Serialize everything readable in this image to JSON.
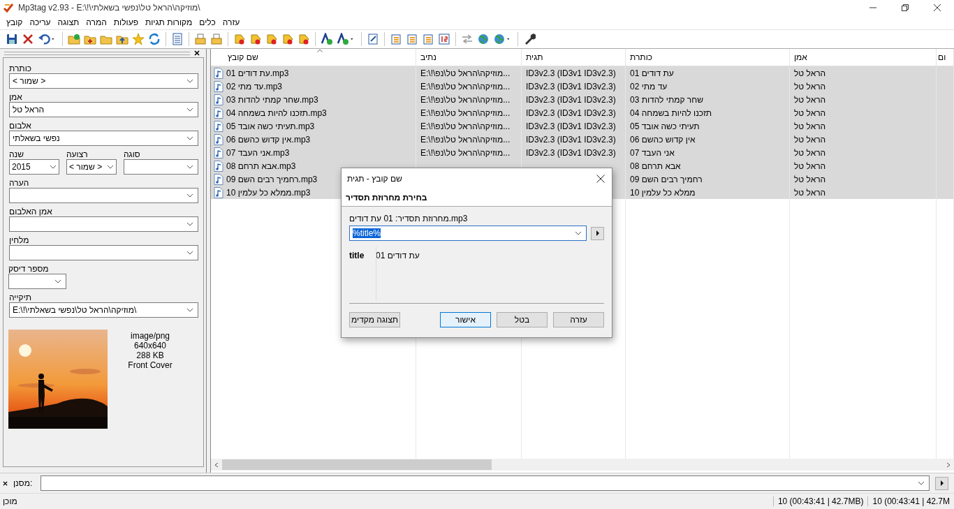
{
  "window": {
    "title": "Mp3tag v2.93  -  E:\\!\\מוזיקה\\הראל טל\\נפשי בשאלתי\\"
  },
  "menu": [
    {
      "label": "עזרה"
    },
    {
      "label": "כלים"
    },
    {
      "label": "מקורות תגיות"
    },
    {
      "label": "פעולות"
    },
    {
      "label": "המרה"
    },
    {
      "label": "תצוגה"
    },
    {
      "label": "עריכה"
    },
    {
      "label": "קובץ"
    }
  ],
  "tag_panel": {
    "fields": [
      {
        "label": "כותרת",
        "value": "< שמור >",
        "kind": "full"
      },
      {
        "label": "אמן",
        "value": "הראל טל",
        "kind": "full"
      },
      {
        "label": "אלבום",
        "value": "נפשי בשאלתי",
        "kind": "full"
      },
      {
        "label": "סוגה",
        "kind": "fill"
      },
      {
        "label": "רצועה",
        "value": "< שמור >",
        "kind": "small"
      },
      {
        "label": "שנה",
        "value": "2015",
        "kind": "small"
      },
      {
        "label": "הערה",
        "kind": "full"
      },
      {
        "label": "אמן האלבום",
        "kind": "full"
      },
      {
        "label": "מלחין",
        "kind": "full"
      },
      {
        "label": "מספר דיסק",
        "kind": "short"
      },
      {
        "label": "תיקייה",
        "value": "E:\\!\\מוזיקה\\הראל טל\\נפשי בשאלתי\\",
        "kind": "full"
      }
    ],
    "cover": {
      "kind": "picture",
      "info": [
        "image/png",
        "640x640",
        "288 KB",
        "Front Cover"
      ]
    }
  },
  "table": {
    "columns": [
      "ום",
      "אמן",
      "כותרת",
      "תגית",
      "נתיב",
      "שם קובץ"
    ],
    "rows": [
      {
        "selected": true,
        "filename": "01 עת דודים.mp3",
        "path": "E:\\!\\מוזיקה\\הראל טל\\נפ...",
        "tag": "ID3v2.3 (ID3v1 ID3v2.3)",
        "title": "01 עת דודים",
        "artist": "הראל טל"
      },
      {
        "selected": true,
        "filename": "02 עד מתי.mp3",
        "path": "E:\\!\\מוזיקה\\הראל טל\\נפ...",
        "tag": "ID3v2.3 (ID3v1 ID3v2.3)",
        "title": "02 עד מתי",
        "artist": "הראל טל"
      },
      {
        "selected": true,
        "filename": "03 שחר קמתי להדות.mp3",
        "path": "E:\\!\\מוזיקה\\הראל טל\\נפ...",
        "tag": "ID3v2.3 (ID3v1 ID3v2.3)",
        "title": "03 שחר קמתי להדות",
        "artist": "הראל טל"
      },
      {
        "selected": true,
        "filename": "04 תזכנו להיות בשמחה.mp3",
        "path": "E:\\!\\מוזיקה\\הראל טל\\נפ...",
        "tag": "ID3v2.3 (ID3v1 ID3v2.3)",
        "title": "04 תזכנו להיות בשמחה",
        "artist": "הראל טל"
      },
      {
        "selected": true,
        "filename": "05 תעיתי כשה אובד.mp3",
        "path": "E:\\!\\מוזיקה\\הראל טל\\נפ...",
        "tag": "ID3v2.3 (ID3v1 ID3v2.3)",
        "title": "05 תעיתי כשה אובד",
        "artist": "הראל טל"
      },
      {
        "selected": true,
        "filename": "06 אין קדוש כהשם.mp3",
        "path": "E:\\!\\מוזיקה\\הראל טל\\נפ...",
        "tag": "ID3v2.3 (ID3v1 ID3v2.3)",
        "title": "06 אין קדוש כהשם",
        "artist": "הראל טל"
      },
      {
        "selected": true,
        "filename": "07 אני העבד.mp3",
        "path": "E:\\!\\מוזיקה\\הראל טל\\נפ...",
        "tag": "ID3v2.3 (ID3v1 ID3v2.3)",
        "title": "07 אני העבד",
        "artist": "הראל טל"
      },
      {
        "selected": true,
        "filename": "08 אבא תרחם.mp3",
        "title": "08 אבא תרחם",
        "artist": "הראל טל"
      },
      {
        "selected": true,
        "filename": "09 רחמיך רבים השם.mp3",
        "title": "09 רחמיך רבים השם",
        "artist": "הראל טל"
      },
      {
        "selected": true,
        "filename": "10 ממלא כל עלמין.mp3",
        "title": "10 ממלא כל עלמין",
        "artist": "הראל טל"
      }
    ]
  },
  "dialog": {
    "title": "שם קובץ - תגית",
    "heading": "בחירת מחרוזת תסדיר",
    "preview_label": "מחרוזת תסדיר: 01 עת דודים.mp3",
    "format_value": "%title%",
    "text_selected": true,
    "results": [
      {
        "field": "title",
        "value": "01 עת דודים"
      }
    ],
    "buttons": [
      {
        "label": "עזרה",
        "default": false
      },
      {
        "label": "בטל",
        "default": false
      },
      {
        "label": "אישור",
        "default": true
      },
      {
        "label": "תצוגה מקדימ",
        "default": false
      }
    ]
  },
  "filter": {
    "label": "מסנן:"
  },
  "status_bar": {
    "left": "מוכן",
    "sections": [
      "10 (00:43:41 | 42.7M",
      "10 (00:43:41 | 42.7MB)"
    ]
  }
}
